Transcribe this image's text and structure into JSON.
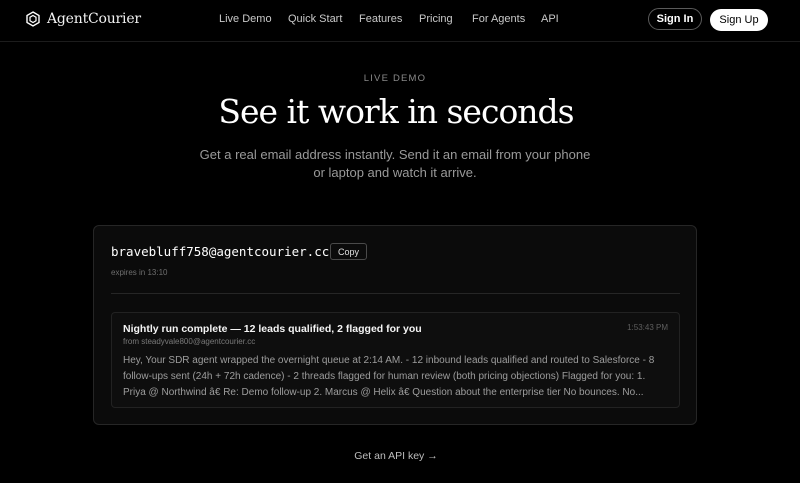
{
  "brand": {
    "name": "AgentCourier",
    "icon": "hexagon-logo-icon"
  },
  "nav": {
    "links": [
      {
        "label": "Live Demo"
      },
      {
        "label": "Quick Start"
      },
      {
        "label": "Features"
      },
      {
        "label": "Pricing"
      },
      {
        "label": "For Agents"
      },
      {
        "label": "API"
      }
    ],
    "sign_in": "Sign In",
    "sign_up": "Sign Up"
  },
  "hero": {
    "eyebrow": "LIVE DEMO",
    "title": "See it work in seconds",
    "subtitle": "Get a real email address instantly. Send it an email from your phone or laptop and watch it arrive."
  },
  "inbox": {
    "address": "bravebluff758@agentcourier.cc",
    "copy_label": "Copy",
    "expires": "expires in 13:10",
    "messages": [
      {
        "subject": "Nightly run complete — 12 leads qualified, 2 flagged for you",
        "from": "from steadyvale800@agentcourier.cc",
        "time": "1:53:43 PM",
        "preview": "Hey, Your SDR agent wrapped the overnight queue at 2:14 AM. - 12 inbound leads qualified and routed to Salesforce - 8 follow-ups sent (24h + 72h cadence) - 2 threads flagged for human review (both pricing objections) Flagged for you: 1. Priya @ Northwind â€    Re: Demo follow-up 2. Marcus @ Helix â€    Question about the enterprise tier No bounces. No..."
      }
    ]
  },
  "footer": {
    "api_link": "Get an API key →"
  },
  "colors": {
    "background": "#000000",
    "accent": "#ffffff",
    "muted": "#9a9a9a"
  }
}
